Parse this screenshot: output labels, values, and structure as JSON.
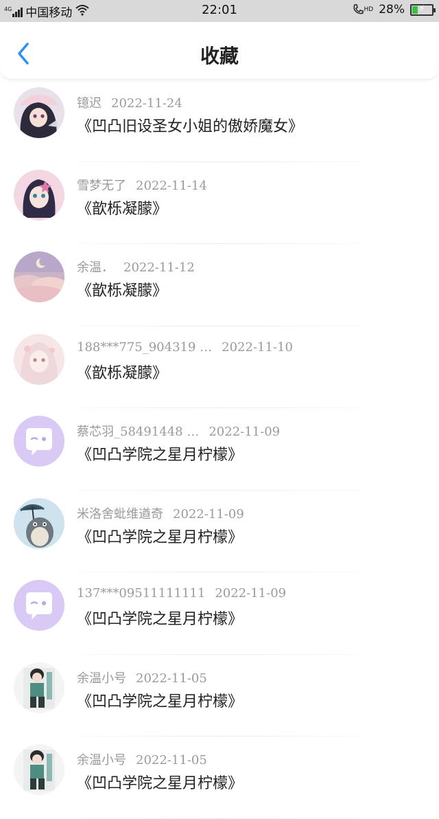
{
  "status_bar": {
    "network": "4G",
    "carrier": "中国移动",
    "time": "22:01",
    "hd": "HD",
    "battery": "28%",
    "battery_level": 0.28
  },
  "header": {
    "title": "收藏"
  },
  "items": [
    {
      "author": "镱迟",
      "date": "2022-11-24",
      "title": "《凹凸旧设圣女小姐的傲娇魔女》",
      "avatar": "anime-girl-dark-avatar"
    },
    {
      "author": "雪梦无了",
      "date": "2022-11-14",
      "title": "《歆栎凝朦》",
      "avatar": "anime-girl-purple-avatar"
    },
    {
      "author": "余温．",
      "date": "2022-11-12",
      "title": "《歆栎凝朦》",
      "avatar": "pink-clouds-avatar"
    },
    {
      "author": "188***775_904319 …",
      "date": "2022-11-10",
      "title": "《歆栎凝朦》",
      "avatar": "anime-girl-white-avatar"
    },
    {
      "author": "蔡芯羽_58491448 …",
      "date": "2022-11-09",
      "title": "《凹凸学院之星月柠檬》",
      "avatar": "default-chat-avatar"
    },
    {
      "author": "米洛舍蚍维遒奇",
      "date": "2022-11-09",
      "title": "《凹凸学院之星月柠檬》",
      "avatar": "totoro-avatar"
    },
    {
      "author": "137***09511111111",
      "date": "2022-11-09",
      "title": "《凹凸学院之星月柠檬》",
      "avatar": "default-chat-avatar"
    },
    {
      "author": "余温小号",
      "date": "2022-11-05",
      "title": "《凹凸学院之星月柠檬》",
      "avatar": "anime-boy-green-avatar"
    },
    {
      "author": "余温小号",
      "date": "2022-11-05",
      "title": "《凹凸学院之星月柠檬》",
      "avatar": "anime-boy-green-avatar"
    }
  ],
  "colors": {
    "accent": "#2a8ff7",
    "default_avatar_bg": "#d9c9f5"
  }
}
